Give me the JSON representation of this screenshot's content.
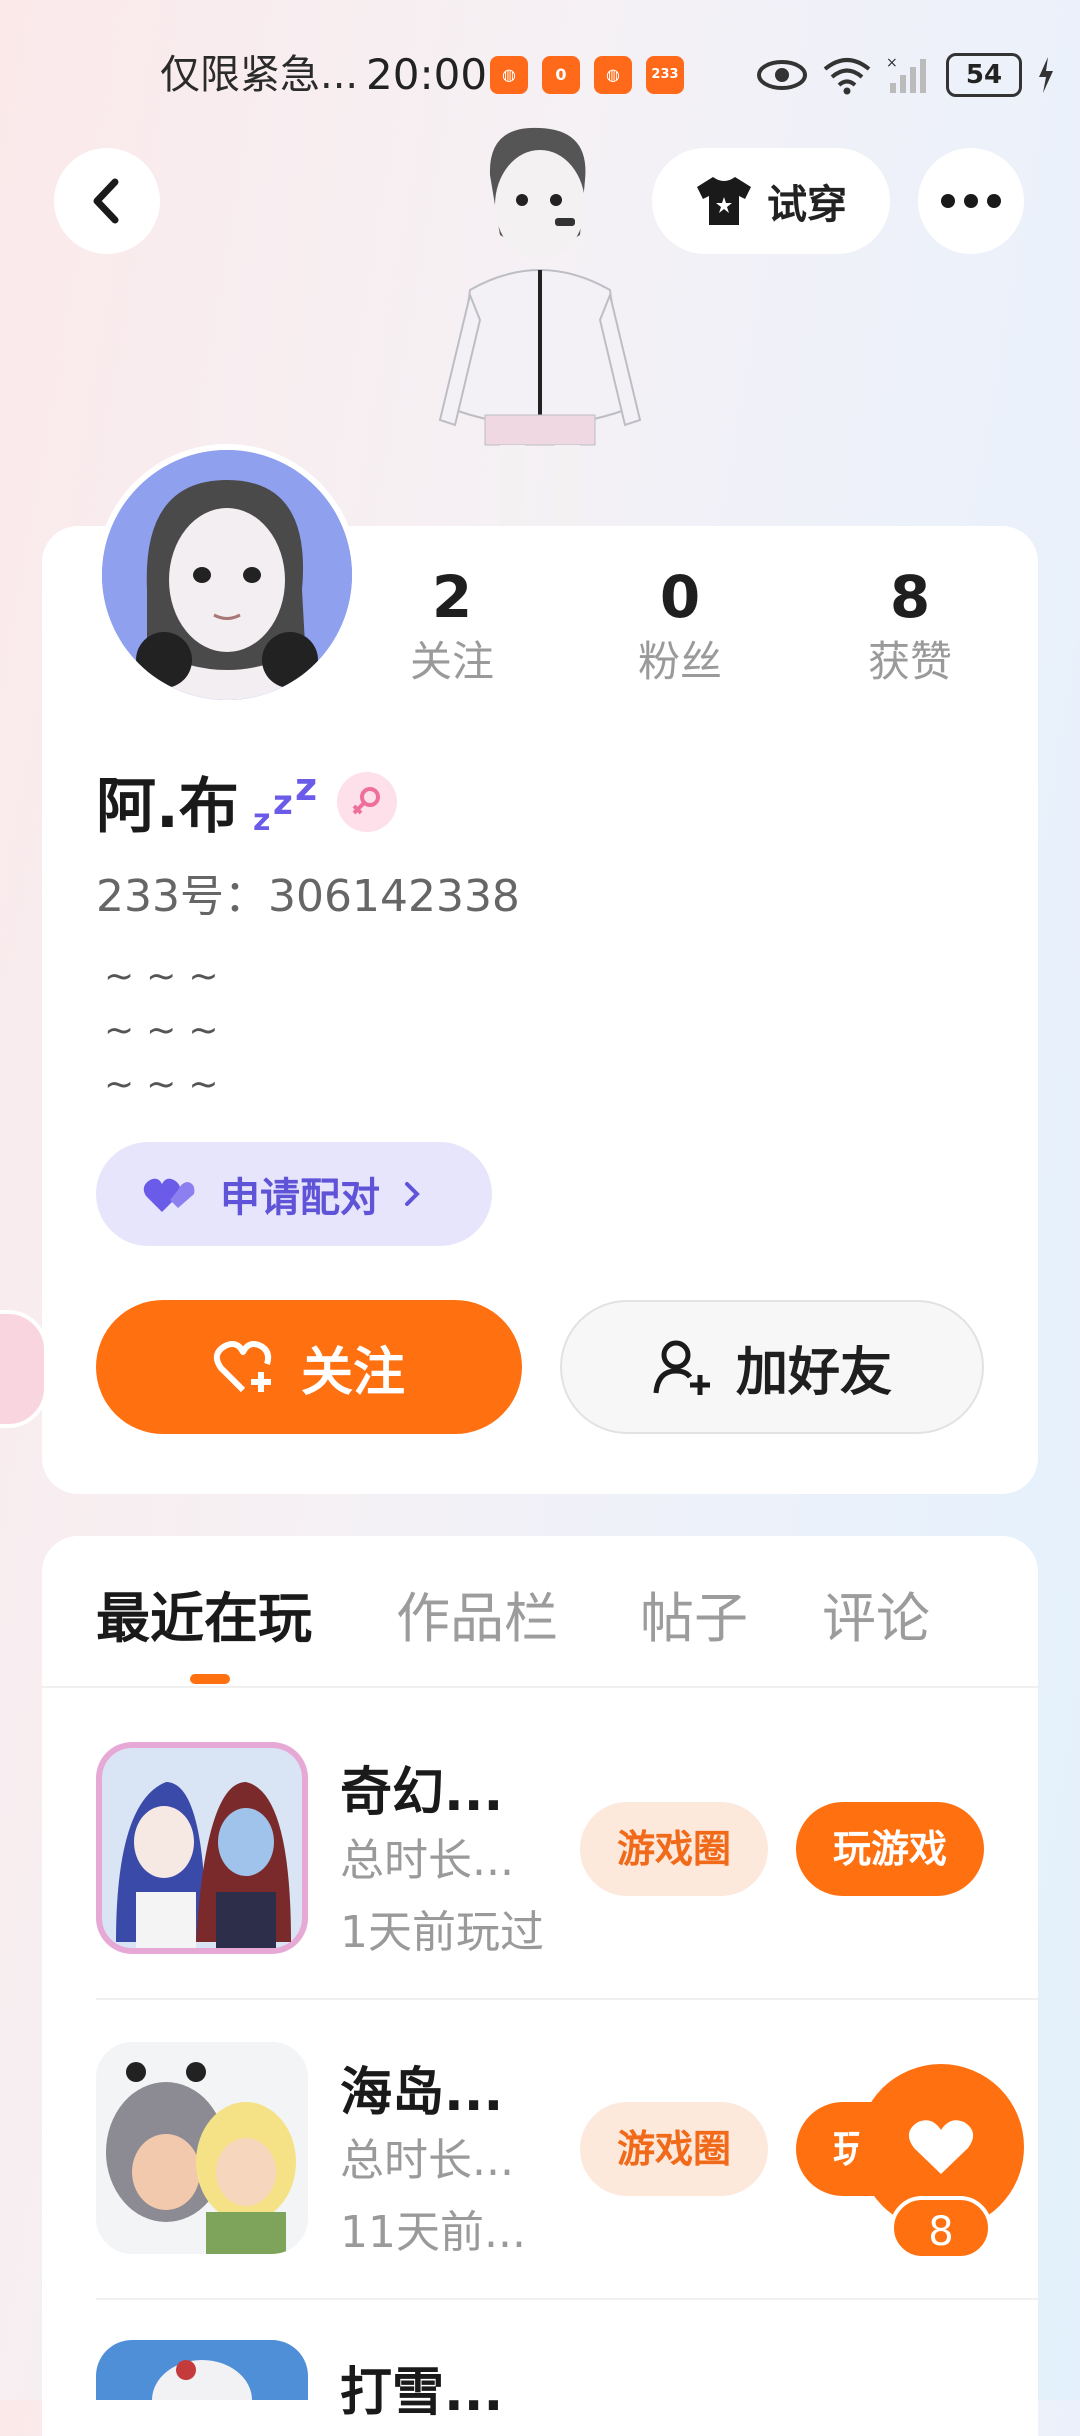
{
  "status_bar": {
    "notice": "仅限紧急...",
    "time": "20:00",
    "app_badges": [
      "",
      "0",
      "",
      "233"
    ],
    "battery": "54"
  },
  "header": {
    "tryon_label": "试穿"
  },
  "profile": {
    "stats": [
      {
        "num": "2",
        "label": "关注"
      },
      {
        "num": "0",
        "label": "粉丝"
      },
      {
        "num": "8",
        "label": "获赞"
      }
    ],
    "name": "阿.布",
    "uid": "233号：306142338",
    "bio": "~~~\n~~~\n~~~",
    "pair_label": "申请配对",
    "follow_label": "关注",
    "add_friend_label": "加好友"
  },
  "tabs": [
    "最近在玩",
    "作品栏",
    "帖子",
    "评论"
  ],
  "games": [
    {
      "title": "奇幻...",
      "sub1": "总时长...",
      "sub2": "1天前玩过",
      "circle_label": "游戏圈",
      "play_label": "玩游戏"
    },
    {
      "title": "海岛...",
      "sub1": "总时长...",
      "sub2": "11天前...",
      "circle_label": "游戏圈",
      "play_label": "玩游戏"
    },
    {
      "title": "打雪..."
    }
  ],
  "like_count": "8",
  "colors": {
    "accent": "#ff7010",
    "pair_bg": "#e7e5fb",
    "pair_fg": "#5f53d7"
  }
}
